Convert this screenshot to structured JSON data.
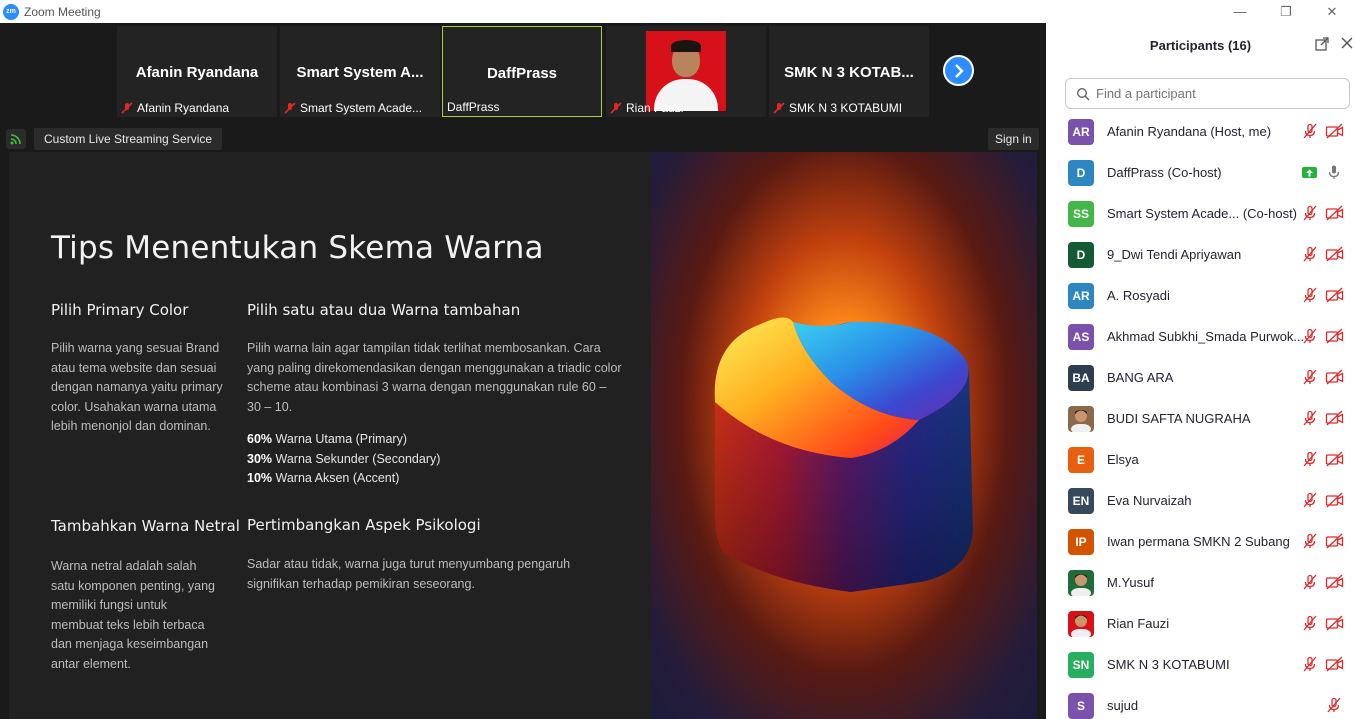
{
  "window": {
    "logo_text": "zm",
    "title": "Zoom Meeting",
    "minimize": "—",
    "restore": "❐",
    "close": "✕"
  },
  "gallery": {
    "tiles": [
      {
        "name": "Afanin Ryandana",
        "label": "Afanin Ryandana",
        "muted": true
      },
      {
        "name": "Smart System A...",
        "label": "Smart System Acade...",
        "muted": true
      },
      {
        "name": "DaffPrass",
        "label": "DaffPrass",
        "muted": false
      },
      {
        "name": "",
        "label": "Rian Fauzi",
        "muted": true
      },
      {
        "name": "SMK N 3 KOTAB...",
        "label": "SMK N 3 KOTABUMI",
        "muted": true
      }
    ]
  },
  "stream": {
    "label": "Custom Live Streaming Service",
    "signin": "Sign in"
  },
  "slide": {
    "title": "Tips Menentukan Skema Warna",
    "s1": {
      "heading": "Pilih Primary Color",
      "body": "Pilih warna yang sesuai Brand atau tema website dan sesuai dengan namanya yaitu primary color. Usahakan warna utama lebih menonjol dan dominan."
    },
    "s2": {
      "heading": "Pilih satu atau dua Warna tambahan",
      "body": "Pilih warna lain agar tampilan tidak terlihat membosankan. Cara yang paling direkomendasikan dengan menggunakan a triadic color scheme atau kombinasi 3 warna dengan menggunakan rule 60 – 30 – 10.",
      "rules": [
        {
          "pct": "60%",
          "text": " Warna Utama (Primary)"
        },
        {
          "pct": "30%",
          "text": " Warna Sekunder (Secondary)"
        },
        {
          "pct": "10%",
          "text": " Warna Aksen (Accent)"
        }
      ]
    },
    "s3": {
      "heading": "Tambahkan Warna Netral",
      "body": "Warna netral adalah salah satu komponen penting, yang memiliki fungsi untuk membuat teks lebih terbaca dan menjaga keseimbangan antar element."
    },
    "s4": {
      "heading": "Pertimbangkan Aspek Psikologi",
      "body": "Sadar atau tidak, warna juga turut menyumbang pengaruh signifikan terhadap pemikiran seseorang."
    }
  },
  "participants": {
    "title": "Participants (16)",
    "search_placeholder": "Find a participant",
    "list": [
      {
        "initials": "AR",
        "color": "#7b52ab",
        "name": "Afanin Ryandana (Host, me)",
        "mic": "muted",
        "cam": "off"
      },
      {
        "initials": "D",
        "color": "#2e86c1",
        "name": "DaffPrass (Co-host)",
        "mic": "on",
        "cam": "share"
      },
      {
        "initials": "SS",
        "color": "#45b649",
        "name": "Smart System Acade...  (Co-host)",
        "mic": "muted",
        "cam": "off"
      },
      {
        "initials": "D",
        "color": "#145a32",
        "name": "9_Dwi Tendi Apriyawan",
        "mic": "muted",
        "cam": "off"
      },
      {
        "initials": "AR",
        "color": "#2e86c1",
        "name": "A. Rosyadi",
        "mic": "muted",
        "cam": "off"
      },
      {
        "initials": "AS",
        "color": "#7b52ab",
        "name": "Akhmad Subkhi_Smada Purwok...",
        "mic": "muted",
        "cam": "off"
      },
      {
        "initials": "BA",
        "color": "#2c3e50",
        "name": "BANG ARA",
        "mic": "muted",
        "cam": "off"
      },
      {
        "initials": "",
        "color": "#8a6a4a",
        "name": "BUDI SAFTA NUGRAHA",
        "mic": "muted",
        "cam": "off",
        "photo": true
      },
      {
        "initials": "E",
        "color": "#e8600f",
        "name": "Elsya",
        "mic": "muted",
        "cam": "off"
      },
      {
        "initials": "EN",
        "color": "#34495e",
        "name": "Eva Nurvaizah",
        "mic": "muted",
        "cam": "off"
      },
      {
        "initials": "IP",
        "color": "#d35400",
        "name": "Iwan permana SMKN 2 Subang",
        "mic": "muted",
        "cam": "off"
      },
      {
        "initials": "",
        "color": "#1f6b3a",
        "name": "M.Yusuf",
        "mic": "muted",
        "cam": "off",
        "photo": true
      },
      {
        "initials": "",
        "color": "#d7101a",
        "name": "Rian Fauzi",
        "mic": "muted",
        "cam": "off",
        "photo": true
      },
      {
        "initials": "SN",
        "color": "#27ae60",
        "name": "SMK N 3 KOTABUMI",
        "mic": "muted",
        "cam": "off"
      },
      {
        "initials": "S",
        "color": "#7b52ab",
        "name": "sujud",
        "mic": "none",
        "cam": "muted-only"
      }
    ]
  },
  "colors": {
    "accent": "#2d8cff",
    "muted_red": "#e02828",
    "active_border": "#a6d13a"
  }
}
